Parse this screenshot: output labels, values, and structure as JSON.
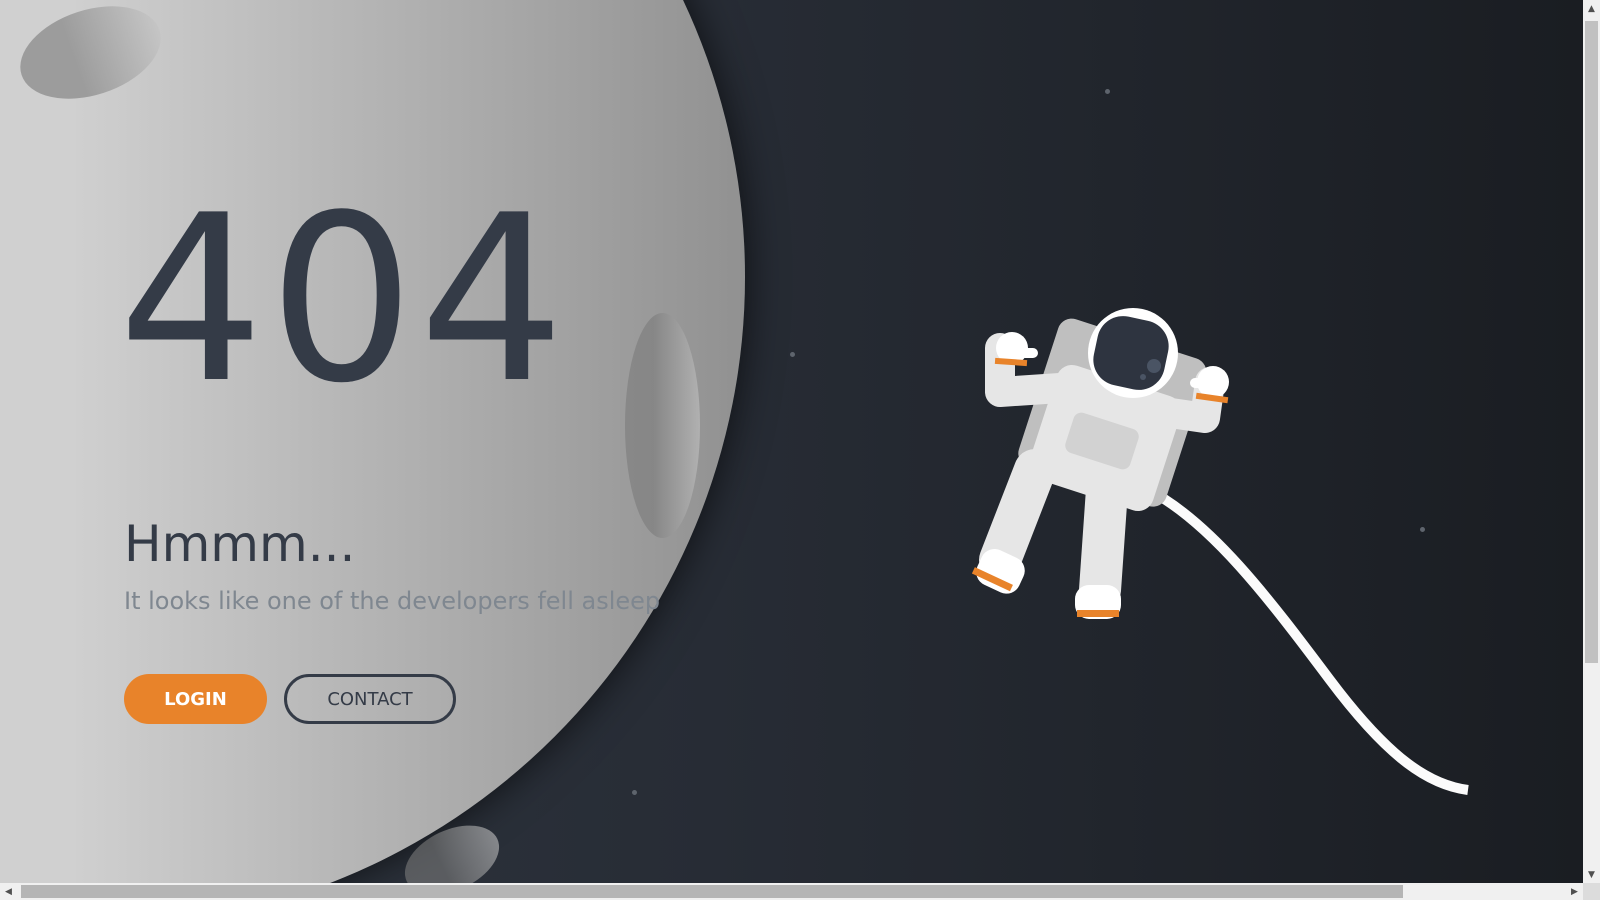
{
  "error": {
    "code": "404",
    "title": "Hmmm...",
    "message": "It looks like one of the developers fell asleep"
  },
  "buttons": {
    "login_label": "LOGIN",
    "contact_label": "CONTACT"
  },
  "colors": {
    "accent": "#e8832a",
    "text_dark": "#343b47",
    "text_muted": "#7f8790",
    "space_background": "#1b1e24",
    "moon": "#c4c4c4"
  },
  "illustration": {
    "moon": "moon-shape",
    "astronaut": "astronaut-icon",
    "tether": "tether-line",
    "stars": "star-dots"
  },
  "scrollbars": {
    "vertical": {
      "up_arrow": "▲",
      "down_arrow": "▼"
    },
    "horizontal": {
      "left_arrow": "◀",
      "right_arrow": "▶"
    }
  }
}
